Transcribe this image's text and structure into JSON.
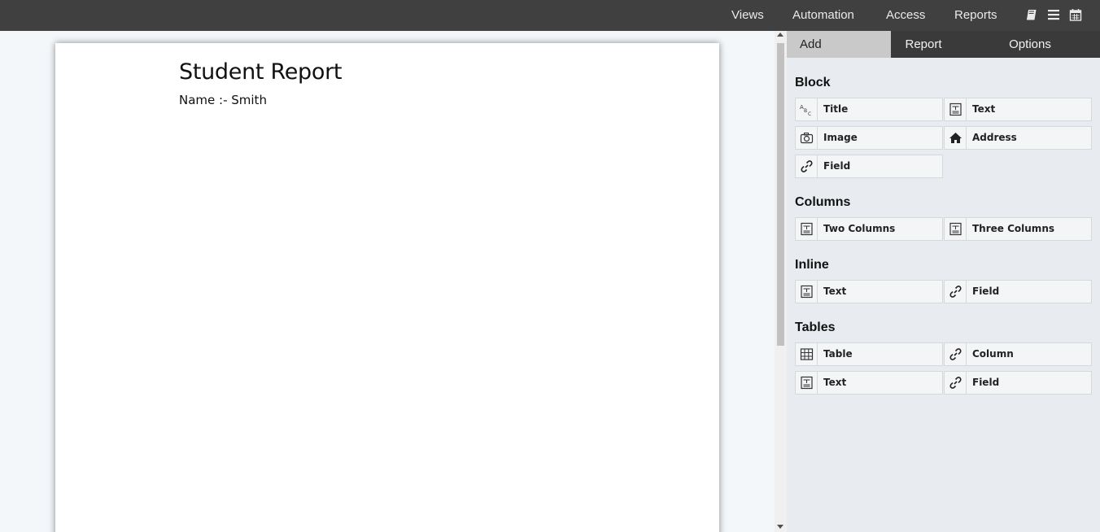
{
  "topbar": {
    "nav": [
      "Views",
      "Automation",
      "Access",
      "Reports"
    ],
    "icons": [
      "book-icon",
      "list-icon",
      "calendar-icon"
    ]
  },
  "document": {
    "title": "Student Report",
    "line": "Name :- Smith"
  },
  "panel": {
    "tabs": [
      "Add",
      "Report",
      "Options"
    ],
    "active_tab": "Add",
    "sections": {
      "block": {
        "title": "Block",
        "items": [
          {
            "label": "Title",
            "icon": "text-format-icon"
          },
          {
            "label": "Text",
            "icon": "text-block-icon"
          },
          {
            "label": "Image",
            "icon": "camera-icon"
          },
          {
            "label": "Address",
            "icon": "home-icon"
          },
          {
            "label": "Field",
            "icon": "link-icon"
          }
        ]
      },
      "columns": {
        "title": "Columns",
        "items": [
          {
            "label": "Two Columns",
            "icon": "text-block-icon"
          },
          {
            "label": "Three Columns",
            "icon": "text-block-icon"
          }
        ]
      },
      "inline": {
        "title": "Inline",
        "items": [
          {
            "label": "Text",
            "icon": "text-block-icon"
          },
          {
            "label": "Field",
            "icon": "link-icon"
          }
        ]
      },
      "tables": {
        "title": "Tables",
        "items": [
          {
            "label": "Table",
            "icon": "table-icon"
          },
          {
            "label": "Column",
            "icon": "link-icon"
          },
          {
            "label": "Text",
            "icon": "text-block-icon"
          },
          {
            "label": "Field",
            "icon": "link-icon"
          }
        ]
      }
    }
  }
}
